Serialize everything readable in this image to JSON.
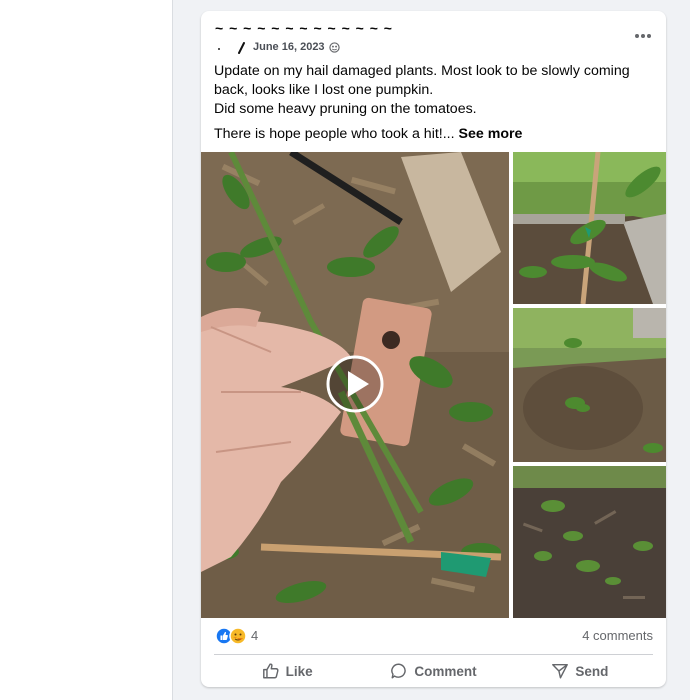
{
  "post": {
    "author_name": "~ ~ ~ ~ ~ ~ ~ ~ ~ ~ ~ ~ ~",
    "date": "June 16, 2023",
    "privacy_icon": "globe-icon",
    "text_line1": "Update on my hail damaged plants. Most look to be slowly coming back, looks like I lost one pumpkin.",
    "text_line2": "Did some heavy pruning on the tomatoes.",
    "text_line3": "There is hope people who took a hit!...",
    "see_more_label": "See more"
  },
  "reactions": {
    "icons": [
      "like-icon",
      "care-icon"
    ],
    "count": "4"
  },
  "comments_label": "4 comments",
  "actions": {
    "like_label": "Like",
    "comment_label": "Comment",
    "send_label": "Send"
  },
  "colors": {
    "brand_blue": "#1877f2",
    "care_yellow": "#f7b928",
    "secondary_text": "#65676b"
  }
}
